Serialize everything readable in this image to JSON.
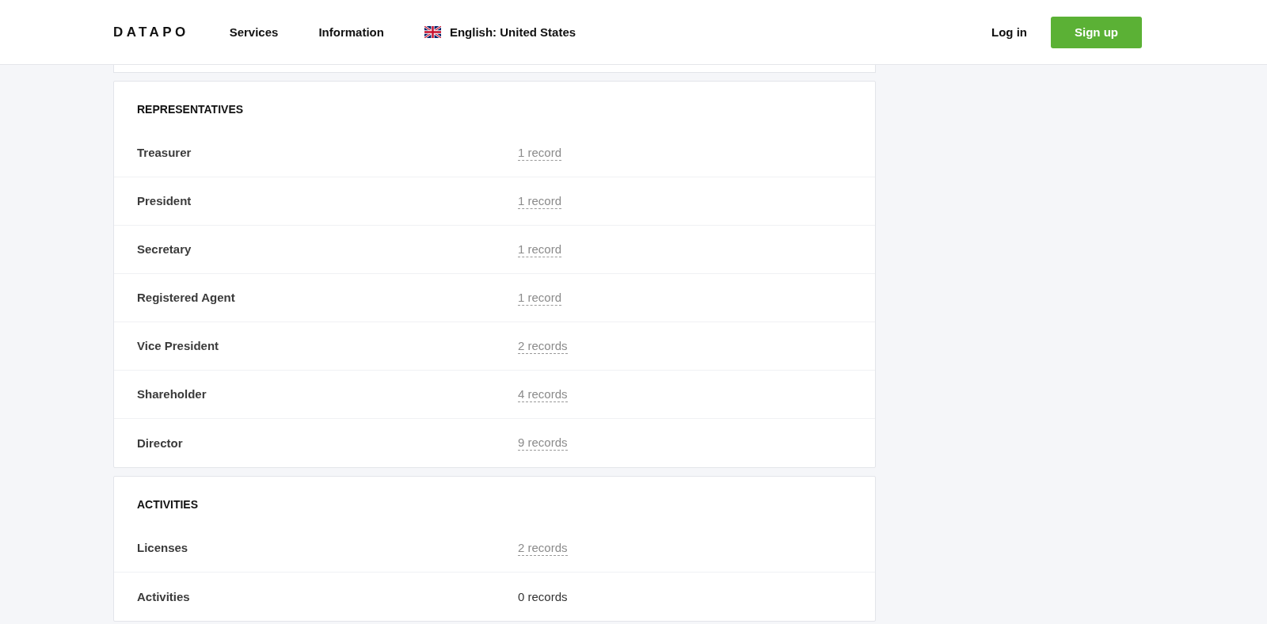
{
  "header": {
    "logo": "DATAPO",
    "nav": [
      {
        "label": "Services"
      },
      {
        "label": "Information"
      }
    ],
    "language": {
      "label": "English: United States"
    },
    "login": "Log in",
    "signup": "Sign up"
  },
  "sections": [
    {
      "title": "REPRESENTATIVES",
      "rows": [
        {
          "label": "Treasurer",
          "value": "1 record",
          "kind": "link"
        },
        {
          "label": "President",
          "value": "1 record",
          "kind": "link"
        },
        {
          "label": "Secretary",
          "value": "1 record",
          "kind": "link"
        },
        {
          "label": "Registered Agent",
          "value": "1 record",
          "kind": "link"
        },
        {
          "label": "Vice President",
          "value": "2 records",
          "kind": "link"
        },
        {
          "label": "Shareholder",
          "value": "4 records",
          "kind": "link"
        },
        {
          "label": "Director",
          "value": "9 records",
          "kind": "link"
        }
      ]
    },
    {
      "title": "ACTIVITIES",
      "rows": [
        {
          "label": "Licenses",
          "value": "2 records",
          "kind": "link"
        },
        {
          "label": "Activities",
          "value": "0 records",
          "kind": "plain"
        }
      ]
    }
  ]
}
